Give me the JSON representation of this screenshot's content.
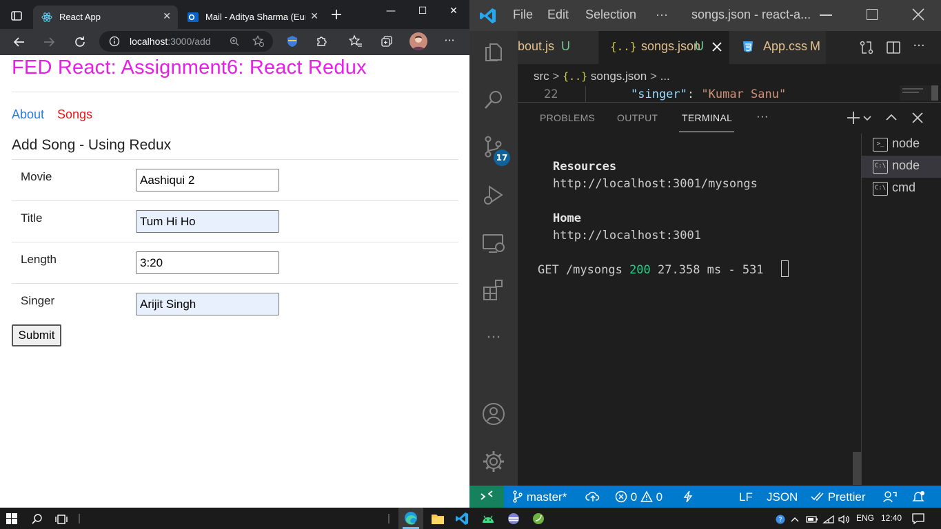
{
  "browser": {
    "tabs": [
      {
        "title": "React App",
        "active": true
      },
      {
        "title": "Mail - Aditya Sharma (Euro",
        "active": false
      }
    ],
    "address": {
      "host": "localhost",
      "rest": ":3000/add"
    },
    "page": {
      "heading": "FED React: Assignment6: React Redux",
      "nav": {
        "about": "About",
        "songs": "Songs"
      },
      "form_title": "Add Song - Using Redux",
      "fields": [
        {
          "label": "Movie",
          "value": "Aashiqui 2"
        },
        {
          "label": "Title",
          "value": "Tum Hi Ho"
        },
        {
          "label": "Length",
          "value": "3:20"
        },
        {
          "label": "Singer",
          "value": "Arijit Singh"
        }
      ],
      "submit_label": "Submit"
    }
  },
  "vscode": {
    "menu": [
      "File",
      "Edit",
      "Selection",
      "···"
    ],
    "window_title": "songs.json - react-a...",
    "tabs": [
      {
        "name": "bout.js",
        "status": "U"
      },
      {
        "name": "songs.json",
        "status": "U"
      },
      {
        "name": "App.css",
        "status": "M"
      }
    ],
    "breadcrumb": {
      "folder": "src",
      "file": "songs.json",
      "more": "..."
    },
    "code": {
      "line_number": "22",
      "key": "\"singer\"",
      "colon": ": ",
      "value": "\"Kumar Sanu\""
    },
    "panel_tabs": {
      "problems": "PROBLEMS",
      "output": "OUTPUT",
      "terminal": "TERMINAL",
      "more": "···"
    },
    "terminal": {
      "resources_label": "Resources",
      "resources_url": "http://localhost:3001/mysongs",
      "home_label": "Home",
      "home_url": "http://localhost:3001",
      "log_method_path": "GET /mysongs ",
      "log_status": "200",
      "log_rest": " 27.358 ms - 531"
    },
    "terminals": [
      {
        "name": "node",
        "icon": ">_"
      },
      {
        "name": "node",
        "icon": "C:\\"
      },
      {
        "name": "cmd",
        "icon": "C:\\"
      }
    ],
    "source_control_badge": "17",
    "status": {
      "branch": "master*",
      "errors": "0",
      "warnings": "0",
      "eol": "LF",
      "language": "JSON",
      "formatter": "Prettier"
    }
  },
  "taskbar": {
    "language": "ENG",
    "time": "12:40"
  },
  "colors": {
    "heading": "#e91ee9",
    "link": "#2b7bd6",
    "active_link": "#e81818",
    "status_bar": "#007acc",
    "status_green": "#23d18b"
  }
}
